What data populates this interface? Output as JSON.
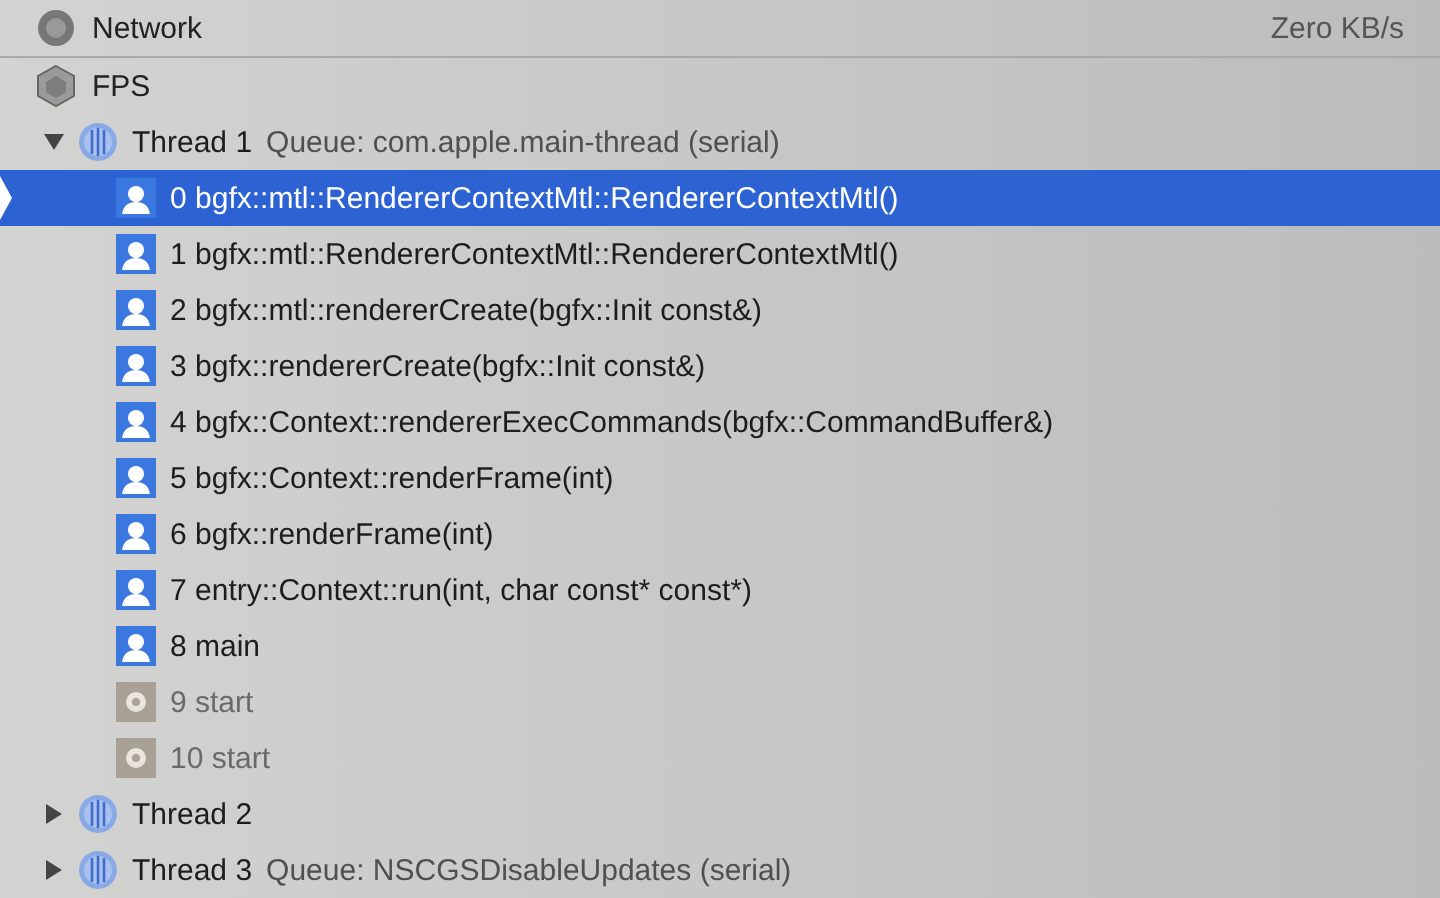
{
  "gauges": [
    {
      "kind": "network",
      "label": "Network",
      "value": "Zero KB/s"
    },
    {
      "kind": "fps",
      "label": "FPS"
    }
  ],
  "threads": [
    {
      "name": "Thread 1",
      "queue": "Queue: com.apple.main-thread (serial)",
      "expanded": true,
      "frames": [
        {
          "index": "0",
          "symbol": "bgfx::mtl::RendererContextMtl::RendererContextMtl()",
          "kind": "user",
          "selected": true
        },
        {
          "index": "1",
          "symbol": "bgfx::mtl::RendererContextMtl::RendererContextMtl()",
          "kind": "user",
          "selected": false
        },
        {
          "index": "2",
          "symbol": "bgfx::mtl::rendererCreate(bgfx::Init const&)",
          "kind": "user",
          "selected": false
        },
        {
          "index": "3",
          "symbol": "bgfx::rendererCreate(bgfx::Init const&)",
          "kind": "user",
          "selected": false
        },
        {
          "index": "4",
          "symbol": "bgfx::Context::rendererExecCommands(bgfx::CommandBuffer&)",
          "kind": "user",
          "selected": false
        },
        {
          "index": "5",
          "symbol": "bgfx::Context::renderFrame(int)",
          "kind": "user",
          "selected": false
        },
        {
          "index": "6",
          "symbol": "bgfx::renderFrame(int)",
          "kind": "user",
          "selected": false
        },
        {
          "index": "7",
          "symbol": "entry::Context::run(int, char const* const*)",
          "kind": "user",
          "selected": false
        },
        {
          "index": "8",
          "symbol": "main",
          "kind": "user",
          "selected": false
        },
        {
          "index": "9",
          "symbol": "start",
          "kind": "system",
          "selected": false
        },
        {
          "index": "10",
          "symbol": "start",
          "kind": "system",
          "selected": false
        }
      ]
    },
    {
      "name": "Thread 2",
      "expanded": false
    },
    {
      "name": "Thread 3",
      "queue": "Queue: NSCGSDisableUpdates (serial)",
      "expanded": false
    }
  ]
}
